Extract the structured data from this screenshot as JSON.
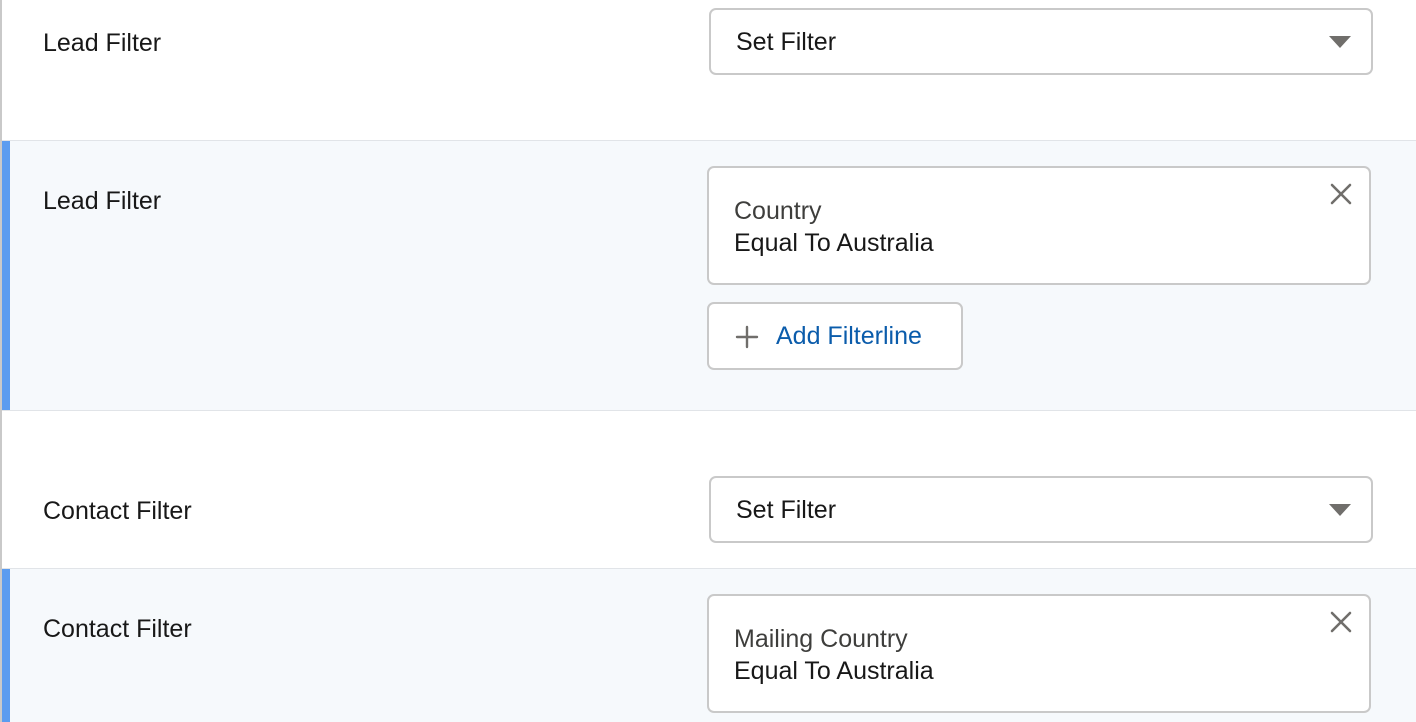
{
  "sections": [
    {
      "label": "Lead Filter",
      "select_value": "Set Filter"
    },
    {
      "label": "Lead Filter",
      "filter_field": "Country",
      "filter_condition": "Equal To Australia",
      "add_button_label": "Add Filterline"
    },
    {
      "label": "Contact Filter",
      "select_value": "Set Filter"
    },
    {
      "label": "Contact Filter",
      "filter_field": "Mailing Country",
      "filter_condition": "Equal To Australia"
    }
  ],
  "icons": {
    "dropdown": "chevron-down-icon",
    "remove": "close-icon",
    "add": "plus-icon"
  },
  "colors": {
    "accent_bar": "#5b9cf0",
    "link": "#0b5cab",
    "highlight_bg": "#f6f9fc",
    "border": "#c9c9c9"
  }
}
